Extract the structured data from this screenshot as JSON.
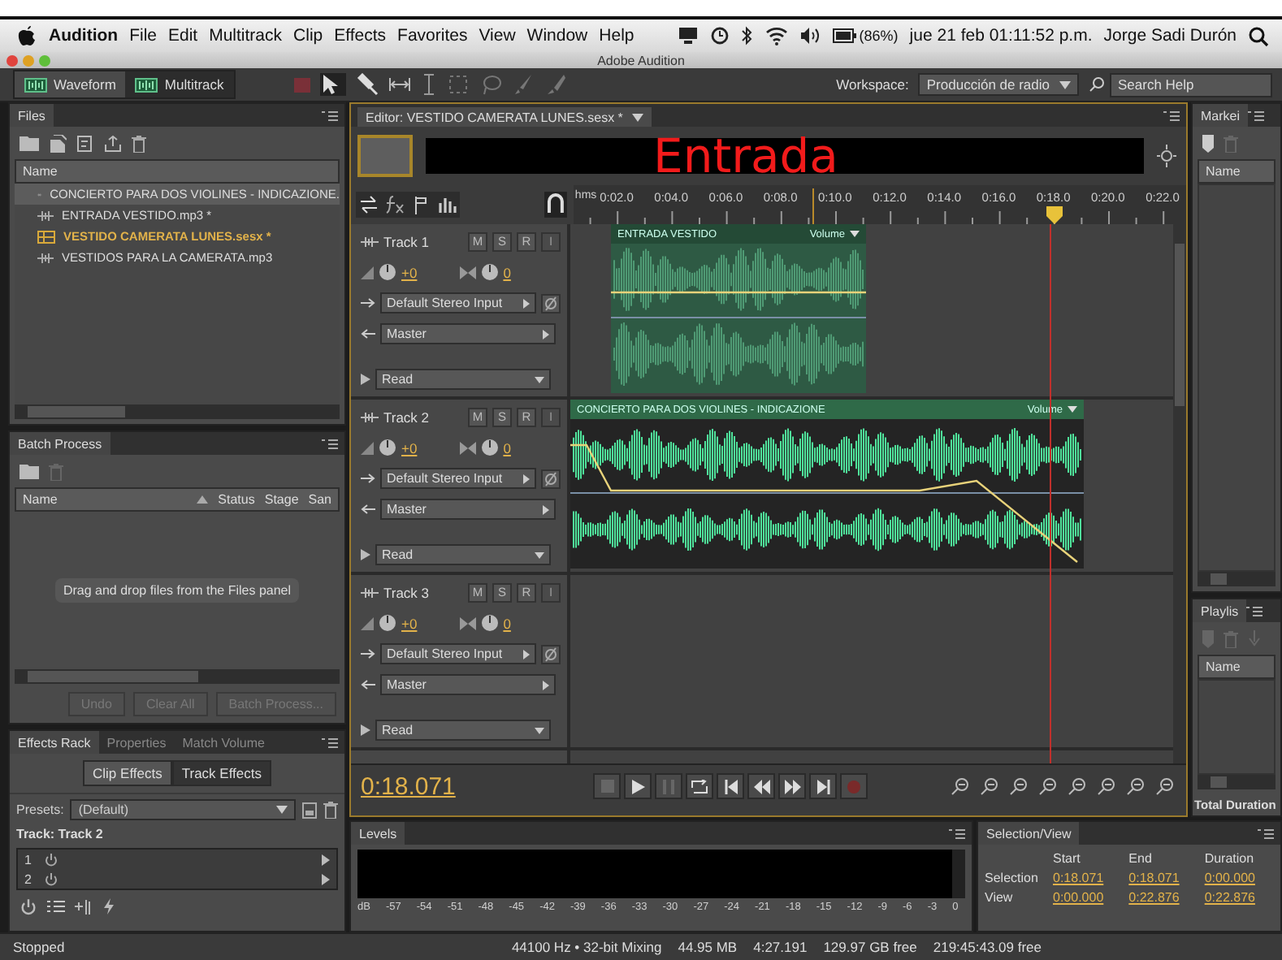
{
  "menubar": {
    "app": "Audition",
    "items": [
      "File",
      "Edit",
      "Multitrack",
      "Clip",
      "Effects",
      "Favorites",
      "View",
      "Window",
      "Help"
    ],
    "battery": "(86%)",
    "clock": "jue 21 feb  01:11:52 p.m.",
    "user": "Jorge Sadi Durón"
  },
  "window": {
    "title": "Adobe Audition"
  },
  "toolbar": {
    "views": [
      {
        "label": "Waveform",
        "selected": false
      },
      {
        "label": "Multitrack",
        "selected": true
      }
    ],
    "workspace_label": "Workspace:",
    "workspace": "Producción de radio",
    "search": {
      "placeholder": "Search Help"
    }
  },
  "files": {
    "title": "Files",
    "column": "Name",
    "items": [
      {
        "name": "CONCIERTO PARA DOS VIOLINES - INDICAZIONE.",
        "kind": "audio",
        "selected": true
      },
      {
        "name": "ENTRADA VESTIDO.mp3 *",
        "kind": "audio",
        "selected": false
      },
      {
        "name": "VESTIDO CAMERATA LUNES.sesx *",
        "kind": "session",
        "selected": false
      },
      {
        "name": "VESTIDOS PARA LA CAMERATA.mp3",
        "kind": "audio",
        "selected": false
      }
    ]
  },
  "batch": {
    "title": "Batch Process",
    "columns": [
      "Name",
      "Status",
      "Stage",
      "San"
    ],
    "message": "Drag and drop files from the Files panel",
    "buttons": [
      {
        "label": "Undo",
        "disabled": true
      },
      {
        "label": "Clear All",
        "disabled": true
      },
      {
        "label": "Batch Process...",
        "disabled": true
      }
    ]
  },
  "effects": {
    "tabs": [
      {
        "label": "Effects Rack",
        "selected": true
      },
      {
        "label": "Properties",
        "selected": false
      },
      {
        "label": "Match Volume",
        "selected": false
      }
    ],
    "modes": [
      {
        "label": "Clip Effects",
        "selected": false
      },
      {
        "label": "Track Effects",
        "selected": true
      }
    ],
    "presets_label": "Presets:",
    "preset": "(Default)",
    "track": "Track: Track 2",
    "slots": [
      "1",
      "2"
    ]
  },
  "editor": {
    "tab": "Editor: VESTIDO CAMERATA LUNES.sesx *",
    "overview_title": "Entrada",
    "ruler_unit": "hms",
    "ticks": [
      "0:02.0",
      "0:04.0",
      "0:06.0",
      "0:08.0",
      "0:10.0",
      "0:12.0",
      "0:14.0",
      "0:16.0",
      "0:18.0",
      "0:20.0",
      "0:22.0"
    ],
    "time": "0:18.071",
    "tracks": [
      {
        "name": "Track 1",
        "volume": "+0",
        "pan": "0",
        "input": "Default Stereo Input",
        "output": "Master",
        "automation": "Read",
        "buttons": [
          {
            "label": "M",
            "disabled": false
          },
          {
            "label": "S",
            "disabled": false
          },
          {
            "label": "R",
            "disabled": false
          },
          {
            "label": "I",
            "disabled": true
          }
        ],
        "clip": {
          "title": "ENTRADA VESTIDO",
          "envelope": "Volume",
          "selected": false
        }
      },
      {
        "name": "Track 2",
        "volume": "+0",
        "pan": "0",
        "input": "Default Stereo Input",
        "output": "Master",
        "automation": "Read",
        "buttons": [
          {
            "label": "M",
            "disabled": false
          },
          {
            "label": "S",
            "disabled": false
          },
          {
            "label": "R",
            "disabled": false
          },
          {
            "label": "I",
            "disabled": true
          }
        ],
        "clip": {
          "title": "CONCIERTO PARA DOS VIOLINES - INDICAZIONE",
          "envelope": "Volume",
          "selected": true
        }
      },
      {
        "name": "Track 3",
        "volume": "+0",
        "pan": "0",
        "input": "Default Stereo Input",
        "output": "Master",
        "automation": "Read",
        "buttons": [
          {
            "label": "M",
            "disabled": false
          },
          {
            "label": "S",
            "disabled": false
          },
          {
            "label": "R",
            "disabled": false
          },
          {
            "label": "I",
            "disabled": true
          }
        ]
      }
    ]
  },
  "markers": {
    "title": "Markei",
    "column": "Name"
  },
  "playlist": {
    "title": "Playlis",
    "column": "Name",
    "footer": "Total Duration"
  },
  "levels": {
    "title": "Levels",
    "scale": [
      "dB",
      "-57",
      "-54",
      "-51",
      "-48",
      "-45",
      "-42",
      "-39",
      "-36",
      "-33",
      "-30",
      "-27",
      "-24",
      "-21",
      "-18",
      "-15",
      "-12",
      "-9",
      "-6",
      "-3",
      "0"
    ]
  },
  "selection_view": {
    "title": "Selection/View",
    "columns": [
      "Start",
      "End",
      "Duration"
    ],
    "rows": [
      {
        "label": "Selection",
        "values": [
          "0:18.071",
          "0:18.071",
          "0:00.000"
        ]
      },
      {
        "label": "View",
        "values": [
          "0:00.000",
          "0:22.876",
          "0:22.876"
        ]
      }
    ]
  },
  "status_bar": {
    "state": "Stopped",
    "items": [
      "44100 Hz • 32-bit Mixing",
      "44.95 MB",
      "4:27.191",
      "129.97 GB free",
      "219:45:43.09 free"
    ]
  }
}
